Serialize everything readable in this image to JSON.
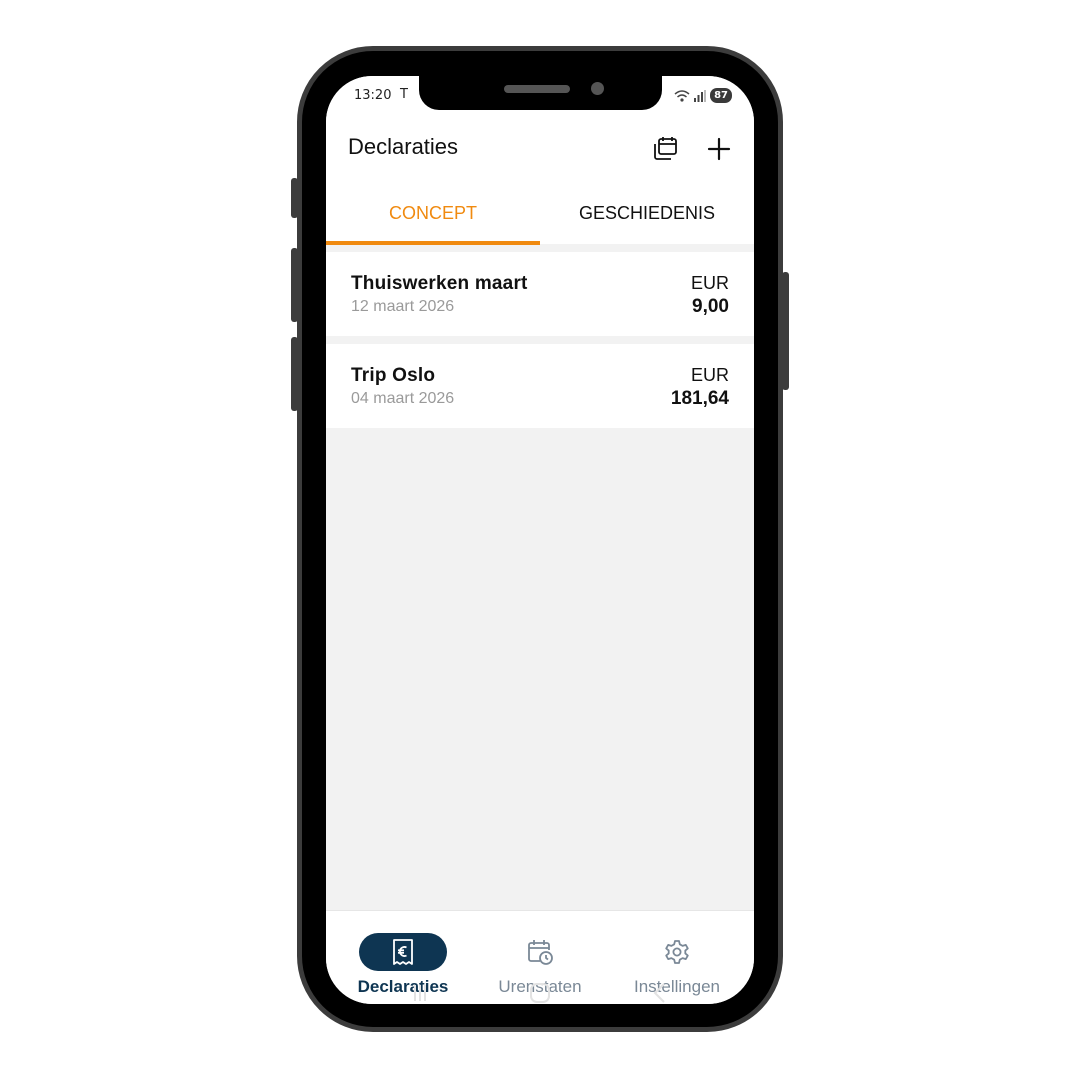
{
  "status_bar": {
    "time": "13:20",
    "carrier_glyph": "T",
    "battery": "87"
  },
  "header": {
    "title": "Declaraties",
    "icons": [
      "calendar-copy-icon",
      "plus-icon"
    ]
  },
  "tabs": [
    {
      "label": "CONCEPT",
      "active": true
    },
    {
      "label": "GESCHIEDENIS",
      "active": false
    }
  ],
  "claims": [
    {
      "title": "Thuiswerken maart",
      "date": "12 maart 2026",
      "currency": "EUR",
      "amount": "9,00"
    },
    {
      "title": "Trip Oslo",
      "date": "04 maart 2026",
      "currency": "EUR",
      "amount": "181,64"
    }
  ],
  "bottom_nav": [
    {
      "label": "Declaraties",
      "icon": "receipt-euro-icon",
      "active": true
    },
    {
      "label": "Urenstaten",
      "icon": "calendar-clock-icon",
      "active": false
    },
    {
      "label": "Instellingen",
      "icon": "gear-icon",
      "active": false
    }
  ],
  "colors": {
    "accent": "#f08a10",
    "nav_active": "#0e3552",
    "nav_inactive": "#7a8896",
    "background": "#f2f2f2"
  }
}
